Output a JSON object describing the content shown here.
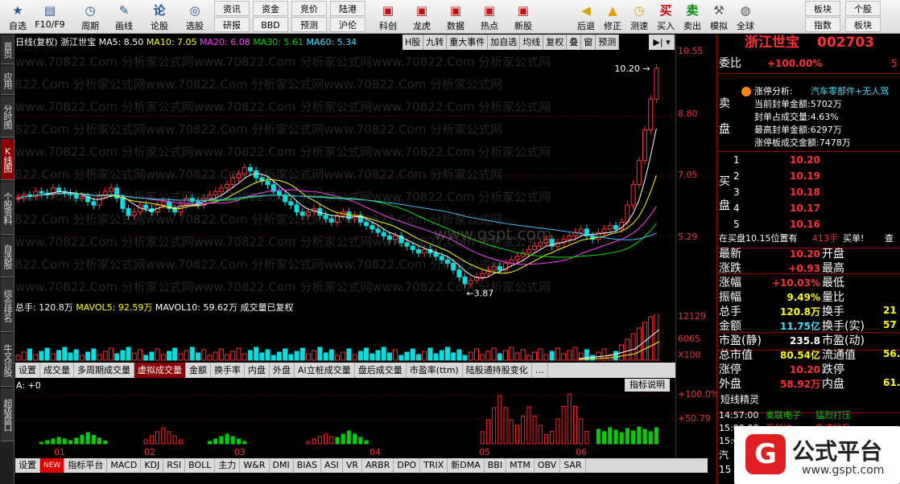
{
  "toolbar": {
    "items": [
      {
        "label": "自选",
        "icon": "star-icon"
      },
      {
        "label": "F10/F9",
        "icon": "f10-icon"
      },
      {
        "label": "周期",
        "icon": "clock-icon"
      },
      {
        "label": "画线",
        "icon": "pen-icon"
      },
      {
        "label": "论股",
        "icon": "comment-icon"
      },
      {
        "label": "选股",
        "icon": "screener-icon"
      }
    ],
    "grid": [
      [
        "资讯",
        "资金",
        "竞价",
        "陆港"
      ],
      [
        "研报",
        "BBD",
        "预测",
        "沪伦"
      ]
    ],
    "right": [
      {
        "label": "科创"
      },
      {
        "label": "龙虎"
      },
      {
        "label": "数据"
      },
      {
        "label": "热点"
      },
      {
        "label": "新股"
      }
    ],
    "right2": [
      {
        "label": "后退",
        "icon": "back-arrow-icon"
      },
      {
        "label": "修正",
        "icon": "up-arrow-icon"
      },
      {
        "label": "测速",
        "icon": "clock-icon"
      },
      {
        "label": "买入",
        "icon": "buy-icon"
      },
      {
        "label": "卖出",
        "icon": "sell-icon"
      },
      {
        "label": "模拟",
        "icon": "hammer-icon"
      },
      {
        "label": "全球",
        "icon": "globe-icon"
      }
    ],
    "grid2": [
      [
        "板块",
        "个股"
      ],
      [
        "指数",
        "板块"
      ]
    ],
    "icon_buy": "买",
    "icon_sell": "卖"
  },
  "left_tabs": [
    "首页",
    "应用",
    "分时图",
    "K线图",
    "个股资料",
    "自选股",
    "综合排名",
    "牛叉诊股",
    "超级盘口"
  ],
  "infobar": {
    "title": "日线(复权) 浙江世宝",
    "ma5": "MA5: 8.50",
    "ma10": "MA10: 7.05",
    "ma20": "MA20: 6.08",
    "ma30": "MA30: 5.61",
    "ma60": "MA60: 5.34"
  },
  "tabs1": [
    "H股",
    "九转",
    "重大事件",
    "加自选",
    "均线",
    "复权",
    "叠",
    "窗",
    "预测"
  ],
  "axis_price": [
    "10.55",
    "8.80",
    "7.05",
    "5.29"
  ],
  "axis_vol": [
    "12129",
    "6065",
    "X100"
  ],
  "axis_ind": [
    "+100.0%",
    "+50.79"
  ],
  "price_labels": {
    "high": "10.20",
    "low": "3.87"
  },
  "volbar": {
    "total": "总手: 120.8万",
    "mavol5": "MAVOL5: 92.59万",
    "mavol10": "MAVOL10: 59.62万",
    "note": "成交量已复权"
  },
  "tabs2": [
    "设置",
    "成交量",
    "多周期成交量",
    "虚拟成交量",
    "金额",
    "换手率",
    "内盘",
    "外盘",
    "AI立桩成交量",
    "盘后成交量",
    "市盈率(ttm)",
    "陆股通持股变化",
    "…"
  ],
  "tabs2_active": "虚拟成交量",
  "ind_label": "A: +0",
  "ind_btn": "指标说明",
  "months": [
    "01",
    "02",
    "03",
    "04",
    "05",
    "06"
  ],
  "tabs3": [
    "设置",
    "NEW",
    "指标平台",
    "MACD",
    "KDJ",
    "RSI",
    "BOLL",
    "主力",
    "W&R",
    "DMI",
    "BIAS",
    "ASI",
    "VR",
    "ARBR",
    "DPO",
    "TRIX",
    "新DMA",
    "BBI",
    "MTM",
    "OBV",
    "SAR"
  ],
  "watermark": "www.70822.Com 分析家公式网",
  "gspt_mark": "www.gspt.com",
  "rp": {
    "name": "浙江世宝",
    "code": "002703",
    "weibi_label": "委比",
    "weibi": "+100.00%",
    "zt_title": "涨停分析:",
    "zt_desc": "汽车零部件+无人驾",
    "zt_lines": [
      "当前封单金额:5702万",
      "封单占成交量:4.63%",
      "最高封单金额:6297万",
      "涨停板成交金额:7478万"
    ],
    "sell_label": "卖盘",
    "buy_label": "买盘",
    "bids": [
      {
        "n": "1",
        "p": "10.20"
      },
      {
        "n": "2",
        "p": "10.19"
      },
      {
        "n": "3",
        "p": "10.18"
      },
      {
        "n": "4",
        "p": "10.17"
      },
      {
        "n": "5",
        "p": "10.16"
      }
    ],
    "zaimai": "在买盘10.15位置有",
    "zaimai_vol": "413手",
    "zaimai_act": "买单!",
    "zaimai_end": "查",
    "quotes": [
      {
        "l": "最新",
        "v": "10.20",
        "l2": "开盘",
        "cl": "red"
      },
      {
        "l": "涨跌",
        "v": "+0.93",
        "l2": "最高",
        "cl": "red"
      },
      {
        "l": "涨幅",
        "v": "+10.03%",
        "l2": "最低",
        "cl": "red"
      },
      {
        "l": "振幅",
        "v": "9.49%",
        "l2": "量比",
        "cl": "yel"
      },
      {
        "l": "总手",
        "v": "120.8万",
        "l2": "换手",
        "cl": "yel"
      },
      {
        "l": "金额",
        "v": "11.75亿",
        "l2": "换手(实)",
        "cl": "cyan"
      },
      {
        "l": "市盈(静)",
        "v": "235.8",
        "l2": "市盈(动)",
        "cl": "wht"
      },
      {
        "l": "总市值",
        "v": "80.54亿",
        "l2": "流通值",
        "cl": "yel"
      },
      {
        "l": "涨停",
        "v": "10.20",
        "l2": "跌停",
        "cl": "red"
      },
      {
        "l": "外盘",
        "v": "58.92万",
        "l2": "内盘",
        "cl": "red"
      }
    ],
    "right_partial": [
      "5",
      "21",
      "57",
      "56.",
      "61."
    ],
    "dxjl": "短线精灵",
    "events": [
      {
        "t": "14:57:00",
        "s": "奥联电子",
        "e": "猛烈打压",
        "c": "grn"
      },
      {
        "t": "15:00:00",
        "s": "汇创达",
        "e": "急速拉升",
        "c": "red"
      },
      {
        "t": "15:00:00",
        "s": "",
        "e": "",
        "c": "grn"
      }
    ],
    "bottom_partial": [
      "汽",
      "15"
    ]
  },
  "logo": {
    "brand": "公式平台",
    "url": "www.gspt.com"
  },
  "chart_data": {
    "type": "candlestick",
    "title": "日线(复权) 浙江世宝",
    "ylim": [
      3.5,
      10.55
    ],
    "price_ticks": [
      10.55,
      8.8,
      7.05,
      5.29
    ],
    "high_point": 10.2,
    "low_point": 3.87,
    "months": [
      "01",
      "02",
      "03",
      "04",
      "05",
      "06"
    ],
    "closes": [
      6.4,
      6.5,
      6.45,
      6.6,
      6.55,
      6.5,
      6.7,
      6.6,
      6.55,
      6.5,
      6.4,
      6.45,
      6.3,
      6.2,
      6.5,
      6.6,
      6.7,
      6.4,
      6.1,
      5.9,
      6.0,
      6.2,
      6.1,
      6.0,
      6.2,
      6.3,
      6.1,
      6.0,
      6.2,
      6.4,
      6.3,
      6.2,
      6.4,
      6.5,
      6.6,
      6.7,
      6.8,
      7.0,
      7.1,
      7.3,
      7.2,
      7.0,
      6.9,
      6.8,
      6.6,
      6.5,
      6.3,
      6.2,
      6.0,
      5.9,
      6.0,
      6.1,
      5.9,
      5.8,
      5.7,
      5.9,
      6.0,
      5.8,
      5.9,
      5.7,
      5.6,
      5.5,
      5.4,
      5.3,
      5.2,
      5.3,
      5.1,
      5.0,
      4.9,
      4.8,
      4.9,
      4.8,
      4.7,
      4.6,
      4.5,
      4.3,
      4.1,
      3.9,
      4.0,
      4.1,
      4.2,
      4.3,
      4.4,
      4.3,
      4.5,
      4.6,
      4.7,
      4.8,
      4.9,
      5.0,
      5.1,
      5.2,
      5.0,
      5.1,
      5.2,
      5.3,
      5.4,
      5.5,
      5.3,
      5.2,
      5.4,
      5.5,
      5.6,
      5.5,
      5.7,
      6.2,
      6.8,
      7.5,
      8.4,
      9.3,
      10.2
    ],
    "vol_ticks": [
      12129,
      6065
    ],
    "indicator_ticks": [
      "+100.0%",
      "+50.79"
    ]
  }
}
